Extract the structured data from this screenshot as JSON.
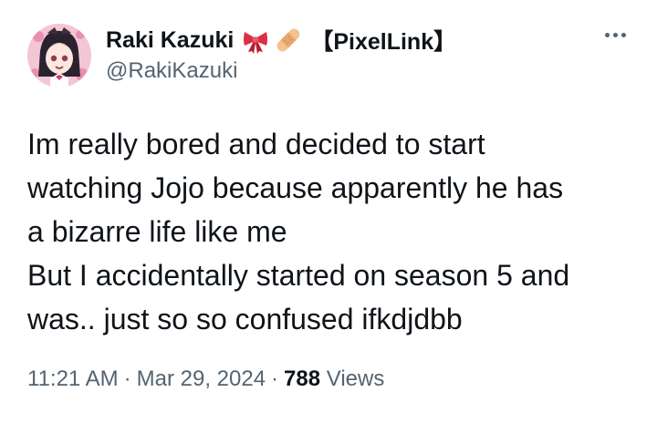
{
  "user": {
    "display_name": "Raki Kazuki",
    "name_tag": "【PixelLink】",
    "handle": "@RakiKazuki",
    "emojis": [
      "ribbon-emoji",
      "bandage-emoji"
    ],
    "avatar_icon": "avatar-image"
  },
  "more_icon": "more-options-icon",
  "tweet": {
    "lines": [
      "Im really bored and decided to start",
      "watching Jojo because apparently he has",
      "a bizarre life like me",
      "But I accidentally started on season 5 and",
      "was.. just so so confused ifkdjdbb"
    ]
  },
  "meta": {
    "time": "11:21 AM",
    "separator": "·",
    "date": "Mar 29, 2024",
    "views_count": "788",
    "views_label": "Views"
  },
  "colors": {
    "text_primary": "#0f1419",
    "text_secondary": "#536471",
    "background": "#ffffff"
  }
}
